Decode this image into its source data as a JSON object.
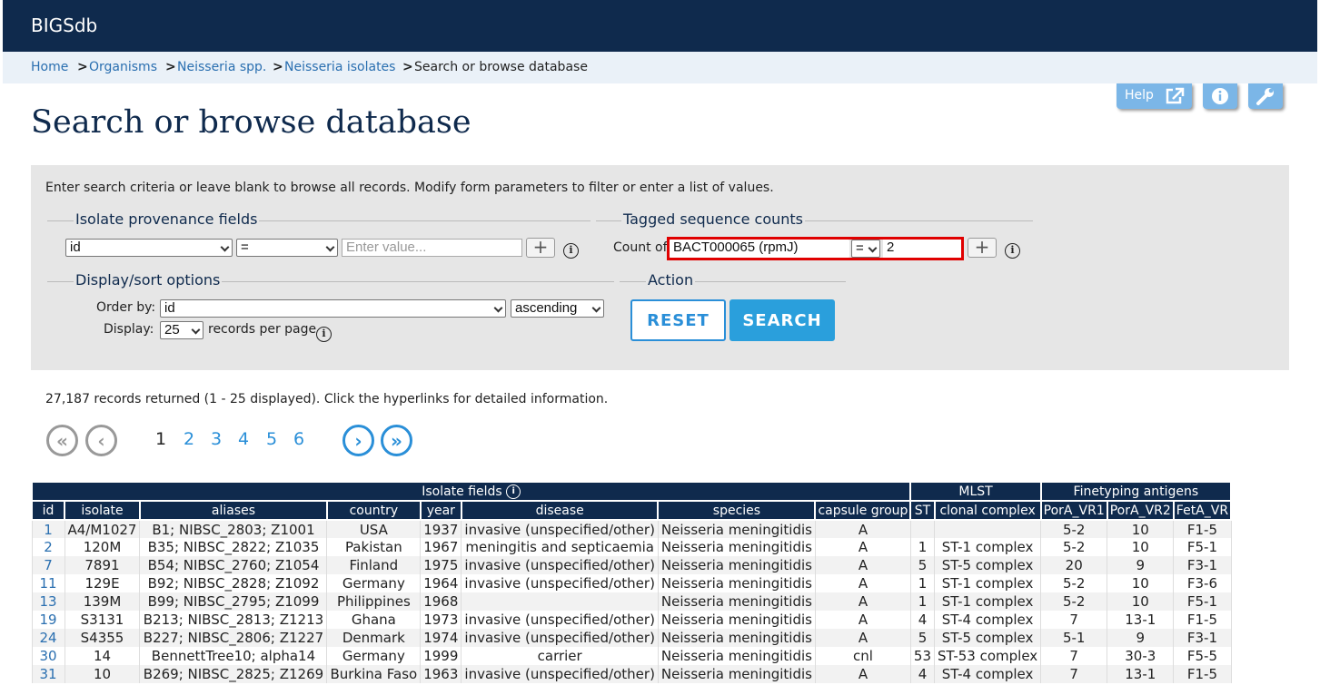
{
  "header": {
    "brand": "BIGSdb"
  },
  "breadcrumb": {
    "items": [
      "Home",
      "Organisms",
      "Neisseria spp.",
      "Neisseria isolates"
    ],
    "current": "Search or browse database",
    "separator": ">"
  },
  "toolbar": {
    "help_label": "Help"
  },
  "page": {
    "title": "Search or browse database"
  },
  "form": {
    "intro": "Enter search criteria or leave blank to browse all records. Modify form parameters to filter or enter a list of values.",
    "provenance": {
      "legend": "Isolate provenance fields",
      "field": "id",
      "operator": "=",
      "value_placeholder": "Enter value..."
    },
    "tagged": {
      "legend": "Tagged sequence counts",
      "prefix": "Count of",
      "locus": "BACT000065 (rpmJ)",
      "operator": "=",
      "value": "2"
    },
    "display": {
      "legend": "Display/sort options",
      "order_label": "Order by:",
      "order_field": "id",
      "order_dir": "ascending",
      "display_label": "Display:",
      "per_page": "25",
      "per_page_suffix": "records per page"
    },
    "action": {
      "legend": "Action",
      "reset_label": "RESET",
      "search_label": "SEARCH"
    }
  },
  "results": {
    "summary": "27,187 records returned (1 - 25 displayed). Click the hyperlinks for detailed information.",
    "pages": [
      "1",
      "2",
      "3",
      "4",
      "5",
      "6"
    ],
    "current_page": "1"
  },
  "table": {
    "groups": [
      {
        "label": "Isolate fields",
        "span": 8
      },
      {
        "label": "MLST",
        "span": 2
      },
      {
        "label": "Finetyping antigens",
        "span": 3
      }
    ],
    "columns": [
      "id",
      "isolate",
      "aliases",
      "country",
      "year",
      "disease",
      "species",
      "capsule group",
      "ST",
      "clonal complex",
      "PorA_VR1",
      "PorA_VR2",
      "FetA_VR"
    ],
    "rows": [
      [
        "1",
        "A4/M1027",
        "B1; NIBSC_2803; Z1001",
        "USA",
        "1937",
        "invasive (unspecified/other)",
        "Neisseria meningitidis",
        "A",
        "",
        "",
        "5-2",
        "10",
        "F1-5"
      ],
      [
        "2",
        "120M",
        "B35; NIBSC_2822; Z1035",
        "Pakistan",
        "1967",
        "meningitis and septicaemia",
        "Neisseria meningitidis",
        "A",
        "1",
        "ST-1 complex",
        "5-2",
        "10",
        "F5-1"
      ],
      [
        "7",
        "7891",
        "B54; NIBSC_2760; Z1054",
        "Finland",
        "1975",
        "invasive (unspecified/other)",
        "Neisseria meningitidis",
        "A",
        "5",
        "ST-5 complex",
        "20",
        "9",
        "F3-1"
      ],
      [
        "11",
        "129E",
        "B92; NIBSC_2828; Z1092",
        "Germany",
        "1964",
        "invasive (unspecified/other)",
        "Neisseria meningitidis",
        "A",
        "1",
        "ST-1 complex",
        "5-2",
        "10",
        "F3-6"
      ],
      [
        "13",
        "139M",
        "B99; NIBSC_2795; Z1099",
        "Philippines",
        "1968",
        "",
        "Neisseria meningitidis",
        "A",
        "1",
        "ST-1 complex",
        "5-2",
        "10",
        "F5-1"
      ],
      [
        "19",
        "S3131",
        "B213; NIBSC_2813; Z1213",
        "Ghana",
        "1973",
        "invasive (unspecified/other)",
        "Neisseria meningitidis",
        "A",
        "4",
        "ST-4 complex",
        "7",
        "13-1",
        "F1-5"
      ],
      [
        "24",
        "S4355",
        "B227; NIBSC_2806; Z1227",
        "Denmark",
        "1974",
        "invasive (unspecified/other)",
        "Neisseria meningitidis",
        "A",
        "5",
        "ST-5 complex",
        "5-1",
        "9",
        "F3-1"
      ],
      [
        "30",
        "14",
        "BennettTree10; alpha14",
        "Germany",
        "1999",
        "carrier",
        "Neisseria meningitidis",
        "cnl",
        "53",
        "ST-53 complex",
        "7",
        "30-3",
        "F5-5"
      ],
      [
        "31",
        "10",
        "B269; NIBSC_2825; Z1269",
        "Burkina Faso",
        "1963",
        "invasive (unspecified/other)",
        "Neisseria meningitidis",
        "A",
        "4",
        "ST-4 complex",
        "7",
        "13-1",
        "F1-5"
      ]
    ]
  },
  "colors": {
    "nav": "#0f2a4d",
    "accent": "#2a8fd8",
    "panel": "#e6e6e6",
    "highlight_border": "#e00000"
  },
  "icons": [
    "external-link-icon",
    "info-icon",
    "wrench-icon",
    "plus-icon",
    "chevron-down-icon",
    "first-page-icon",
    "prev-page-icon",
    "next-page-icon",
    "last-page-icon"
  ]
}
